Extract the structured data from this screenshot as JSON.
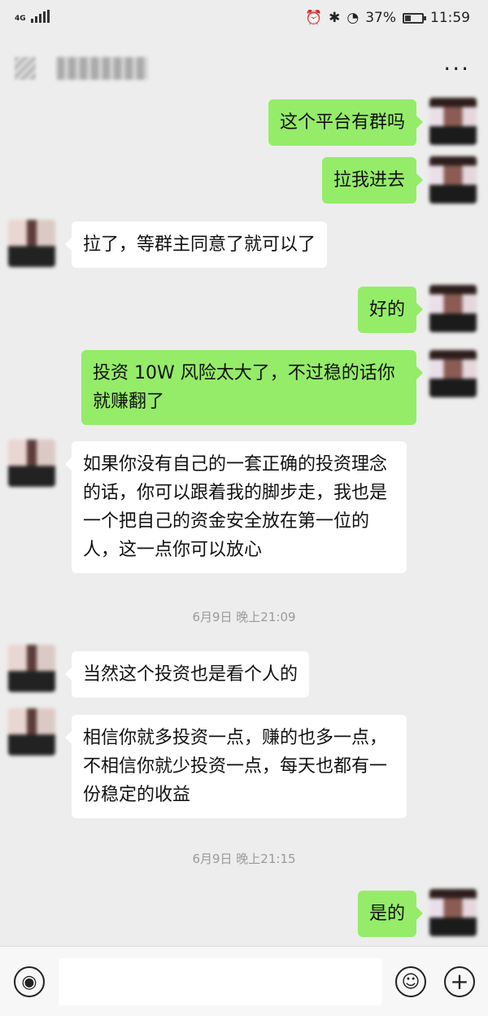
{
  "status_bar": {
    "network": "4G",
    "battery_percent": "37%",
    "battery_level": 0.37,
    "time": "11:59"
  },
  "header": {
    "more_label": "···"
  },
  "messages": [
    {
      "from": "me",
      "text": "这个平台有群吗"
    },
    {
      "from": "me",
      "text": "拉我进去"
    },
    {
      "from": "other",
      "text": "拉了，等群主同意了就可以了"
    },
    {
      "from": "me",
      "text": "好的"
    },
    {
      "from": "me",
      "text": "投资 10W 风险太大了，不过稳的话你就赚翻了"
    },
    {
      "from": "other",
      "text": "如果你没有自己的一套正确的投资理念的话，你可以跟着我的脚步走，我也是一个把自己的资金安全放在第一位的人，这一点你可以放心"
    },
    {
      "from": "other",
      "text": "当然这个投资也是看个人的"
    },
    {
      "from": "other",
      "text": "相信你就多投资一点，赚的也多一点，不相信你就少投资一点，每天也都有一份稳定的收益"
    },
    {
      "from": "me",
      "text": "是的"
    }
  ],
  "timestamps": [
    "6月9日 晚上21:09",
    "6月9日 晚上21:15"
  ],
  "input_bar": {
    "voice_icon": "voice-icon",
    "emoji_icon": "emoji-icon",
    "plus_icon": "plus-icon",
    "emoji_glyph": "☺",
    "plus_glyph": "+",
    "voice_glyph": "◉"
  }
}
